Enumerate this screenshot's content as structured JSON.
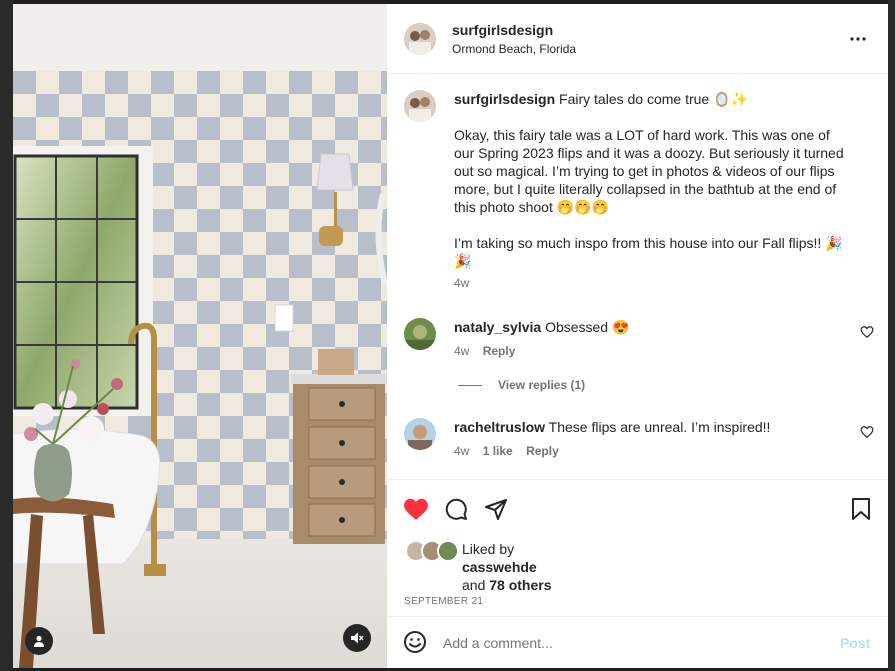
{
  "post": {
    "author": "surfgirlsdesign",
    "location": "Ormond Beach, Florida",
    "more_label": "•••"
  },
  "caption": {
    "author": "surfgirlsdesign",
    "title": "Fairy tales do come true 🪞✨",
    "paragraph1": "Okay, this fairy tale was a LOT of hard work. This was one of our Spring 2023 flips and it was a doozy. But seriously it turned out so magical. I’m trying to get in photos & videos of our flips more, but I quite literally collapsed in the bathtub at the end of this photo shoot 🤭🤭🤭",
    "paragraph2": "I’m taking so much inspo from this house into our Fall flips!! 🎉🎉",
    "age": "4w"
  },
  "comments": [
    {
      "user": "nataly_sylvia",
      "text": "Obsessed 😍",
      "age": "4w",
      "reply_label": "Reply",
      "view_replies": "View replies (1)"
    },
    {
      "user": "racheltruslow",
      "text": "These flips are unreal. I’m inspired!!",
      "age": "4w",
      "likes": "1 like",
      "reply_label": "Reply"
    }
  ],
  "likes": {
    "liked_by_label": "Liked by",
    "liker": "casswehde",
    "and_label": "and",
    "others": "78 others",
    "date": "SEPTEMBER 21"
  },
  "composer": {
    "placeholder": "Add a comment...",
    "post_label": "Post"
  },
  "colors": {
    "like_red": "#ff3040",
    "post_blue": "#b2dffc",
    "secondary_text": "#737373"
  },
  "icons": {
    "liked": "heart-filled-icon",
    "comment": "comment-icon",
    "share": "send-icon",
    "save": "bookmark-icon",
    "emoji": "emoji-icon",
    "profile": "user-icon",
    "audio": "mute-icon",
    "more": "more-icon",
    "comment_like": "heart-outline-icon"
  }
}
